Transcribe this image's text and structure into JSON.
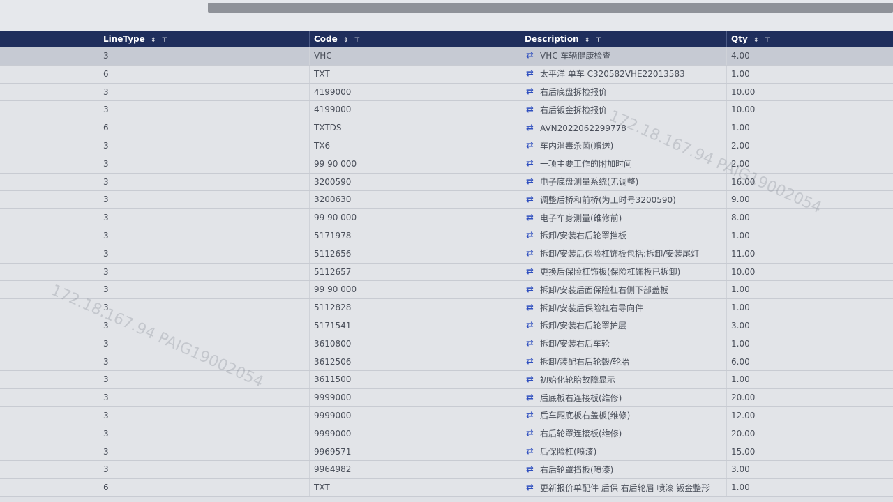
{
  "grid": {
    "columns": [
      {
        "key": "linetype",
        "label": "LineType"
      },
      {
        "key": "code",
        "label": "Code"
      },
      {
        "key": "description",
        "label": "Description"
      },
      {
        "key": "qty",
        "label": "Qty"
      }
    ],
    "sort_glyph": "⇕",
    "filter_glyph": "⊤",
    "swap_glyph": "⇄",
    "rows": [
      {
        "linetype": "3",
        "code": "VHC",
        "description": "VHC 车辆健康检查",
        "qty": "4.00",
        "selected": true
      },
      {
        "linetype": "6",
        "code": "TXT",
        "description": "太平洋 单车 C320582VHE22013583",
        "qty": "1.00"
      },
      {
        "linetype": "3",
        "code": "4199000",
        "description": "右后底盘拆检报价",
        "qty": "10.00"
      },
      {
        "linetype": "3",
        "code": "4199000",
        "description": "右后钣金拆检报价",
        "qty": "10.00"
      },
      {
        "linetype": "6",
        "code": "TXTDS",
        "description": "AVN2022062299778",
        "qty": "1.00"
      },
      {
        "linetype": "3",
        "code": "TX6",
        "description": "车内消毒杀菌(赠送)",
        "qty": "2.00"
      },
      {
        "linetype": "3",
        "code": "99 90 000",
        "description": "一项主要工作的附加时间",
        "qty": "2.00"
      },
      {
        "linetype": "3",
        "code": "3200590",
        "description": "电子底盘测量系统(无调整)",
        "qty": "16.00"
      },
      {
        "linetype": "3",
        "code": "3200630",
        "description": "调整后桥和前桥(为工时号3200590)",
        "qty": "9.00"
      },
      {
        "linetype": "3",
        "code": "99 90 000",
        "description": "电子车身测量(维修前)",
        "qty": "8.00"
      },
      {
        "linetype": "3",
        "code": "5171978",
        "description": "拆卸/安装右后轮罩挡板",
        "qty": "1.00"
      },
      {
        "linetype": "3",
        "code": "5112656",
        "description": "拆卸/安装后保险杠饰板包括:拆卸/安装尾灯",
        "qty": "11.00"
      },
      {
        "linetype": "3",
        "code": "5112657",
        "description": "更换后保险杠饰板(保险杠饰板已拆卸)",
        "qty": "10.00"
      },
      {
        "linetype": "3",
        "code": "99 90 000",
        "description": "拆卸/安装后面保险杠右侧下部盖板",
        "qty": "1.00"
      },
      {
        "linetype": "3",
        "code": "5112828",
        "description": "拆卸/安装后保险杠右导向件",
        "qty": "1.00"
      },
      {
        "linetype": "3",
        "code": "5171541",
        "description": "拆卸/安装右后轮罩护层",
        "qty": "3.00"
      },
      {
        "linetype": "3",
        "code": "3610800",
        "description": "拆卸/安装右后车轮",
        "qty": "1.00"
      },
      {
        "linetype": "3",
        "code": "3612506",
        "description": "拆卸/装配右后轮毂/轮胎",
        "qty": "6.00"
      },
      {
        "linetype": "3",
        "code": "3611500",
        "description": "初始化轮胎故障显示",
        "qty": "1.00"
      },
      {
        "linetype": "3",
        "code": "9999000",
        "description": "后底板右连接板(维修)",
        "qty": "20.00"
      },
      {
        "linetype": "3",
        "code": "9999000",
        "description": "后车厢底板右盖板(维修)",
        "qty": "12.00"
      },
      {
        "linetype": "3",
        "code": "9999000",
        "description": "右后轮罩连接板(维修)",
        "qty": "20.00"
      },
      {
        "linetype": "3",
        "code": "9969571",
        "description": "后保险杠(喷漆)",
        "qty": "15.00"
      },
      {
        "linetype": "3",
        "code": "9964982",
        "description": "右后轮罩挡板(喷漆)",
        "qty": "3.00"
      },
      {
        "linetype": "6",
        "code": "TXT",
        "description": "更新报价单配件 后保 右后轮眉 喷漆 钣金整形",
        "qty": "1.00"
      }
    ]
  },
  "watermarks": [
    "172.18.167.94 PAIG19002054",
    "172.18.167.94 PAIG19002054"
  ]
}
